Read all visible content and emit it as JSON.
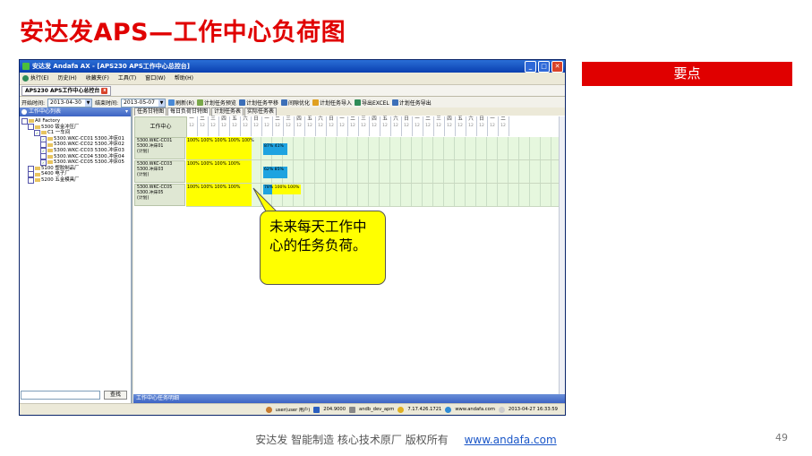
{
  "slide": {
    "title": "安达发APS—工作中心负荷图",
    "keypoint": "要点",
    "footer_text": "安达发   智能制造 核心技术原厂    版权所有",
    "footer_link": "www.andafa.com",
    "page_number": "49",
    "callout": "未来每天工作中心的任务负荷。",
    "colors": {
      "title_red": "#e00000",
      "callout_yellow": "#ffff00",
      "load_yellow": "#ffff00",
      "load_blue": "#1ea3e0",
      "grid_green": "#e6f7de"
    }
  },
  "app": {
    "window_title": "安达发 Andafa AX - [APS230 APS工作中心总控台]",
    "menu": [
      "执行(E)",
      "历史(H)",
      "收藏夹(F)",
      "工具(T)",
      "窗口(W)",
      "帮助(H)"
    ],
    "doc_tab": "APS230 APS工作中心总控台",
    "toolbar": {
      "start_label": "开始时间:",
      "start_value": "2013-04-30",
      "end_label": "结束时间:",
      "end_value": "2013-05-07",
      "buttons": [
        "刷新(R)",
        "计划任务预览",
        "计划任务平移",
        "间隙优化",
        "计划任务导入",
        "导出EXCEL",
        "计划任务导出"
      ]
    },
    "left_panel": {
      "header": "工作中心列表",
      "tree": [
        {
          "level": 0,
          "text": "All Factory",
          "checked": false
        },
        {
          "level": 1,
          "text": "5300 钣金冲压厂",
          "checked": false
        },
        {
          "level": 2,
          "text": "C1 一车间",
          "checked": true
        },
        {
          "level": 3,
          "text": "5300.WKC-CC01 5300.冲床01",
          "checked": true
        },
        {
          "level": 3,
          "text": "5300.WKC-CC02 5300.冲床02",
          "checked": false
        },
        {
          "level": 3,
          "text": "5300.WKC-CC03 5300.冲床03",
          "checked": true
        },
        {
          "level": 3,
          "text": "5300.WKC-CC04 5300.冲床04",
          "checked": false
        },
        {
          "level": 3,
          "text": "5300.WKC-CC05 5300.冲床05",
          "checked": true
        },
        {
          "level": 1,
          "text": "5100 塑胶制品厂",
          "checked": false
        },
        {
          "level": 1,
          "text": "5400 电子厂",
          "checked": false
        },
        {
          "level": 1,
          "text": "5200 五金模具厂",
          "checked": false
        }
      ],
      "search_button": "查找"
    },
    "view_tabs": [
      "任务甘特图",
      "每日负荷甘特图",
      "计划任务表",
      "实际任务表"
    ],
    "grid": {
      "header_label": "工作中心",
      "days": [
        "一",
        "二",
        "三",
        "四",
        "五",
        "六",
        "日",
        "一",
        "二",
        "三",
        "四",
        "五",
        "六",
        "日",
        "一",
        "二",
        "三",
        "四",
        "五",
        "六",
        "日",
        "一",
        "二",
        "三",
        "四",
        "五",
        "六",
        "日",
        "一",
        "二"
      ],
      "day_sub": "12",
      "rows": [
        {
          "name": "5300.WKC-CC01\n5300.冲床01\n(计划)",
          "loads": "100% 100% 100% 100% 100%",
          "extra": "87% 41%"
        },
        {
          "name": "5300.WKC-CC03\n5300.冲床03\n(计划)",
          "loads": "100% 100% 100% 100%",
          "extra": "62% 85%"
        },
        {
          "name": "5300.WKC-CC05\n5300.冲床05\n(计划)",
          "loads": "100% 100% 100% 100%",
          "extra": "78% 100% 100%"
        }
      ]
    },
    "bottom_header": "工作中心任务明细",
    "status": {
      "user": "user(user 用户)",
      "port": "204.9000",
      "db": "andb_dev_apm",
      "ip": "7.17.426.1721",
      "site": "www.andafa.com",
      "time": "2013-04-27 16:33:59"
    }
  }
}
